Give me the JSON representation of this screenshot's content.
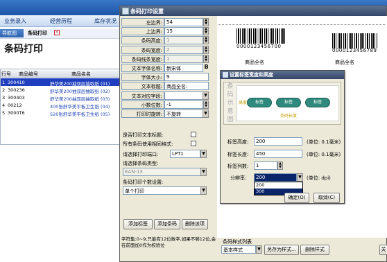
{
  "app": {
    "menu": [
      "业务录入",
      "经营历程",
      "库存状况"
    ],
    "breadcrumb_home": "导航图",
    "breadcrumb_current": "条码打印",
    "page_title": "条码打印",
    "table_headers": [
      "行号",
      "商品编号",
      "商品名名"
    ],
    "rows": [
      {
        "num": "1",
        "code": "300410",
        "name": "舒华美200抽双层抽取纸 (01)",
        "selected": true
      },
      {
        "num": "2",
        "code": "300236",
        "name": "舒华美200抽双层抽取纸 (02)"
      },
      {
        "num": "3",
        "code": "300403",
        "name": "舒华美200抽双层抽取纸 (03)"
      },
      {
        "num": "4",
        "code": "00212",
        "name": "400张舒华美平板卫生纸 (04)"
      },
      {
        "num": "5",
        "code": "3000T6",
        "name": "520张舒华美平板卫生纸 (05)"
      }
    ]
  },
  "dialog": {
    "title": "条码打印设置",
    "fields": [
      {
        "label": "左边界:",
        "value": "54",
        "type": "spin"
      },
      {
        "label": "上边界:",
        "value": "15",
        "type": "spin"
      },
      {
        "label": "条码高度:",
        "value": "1",
        "type": "spin",
        "disabled": true
      },
      {
        "label": "条码宽度:",
        "value": "2",
        "type": "spin",
        "disabled": true
      },
      {
        "label": "条码线条宽度:",
        "value": "1",
        "type": "spin",
        "disabled": true
      },
      {
        "label": "文本字体名称:",
        "value": "新宋体",
        "type": "font"
      },
      {
        "label": "字体大小:",
        "value": "9",
        "type": "plain"
      },
      {
        "label": "文本标题:",
        "value": "商品全名:",
        "type": "plain"
      },
      {
        "label": "文本对应字段:",
        "value": "",
        "type": "dropdown"
      },
      {
        "label": "小数位数:",
        "value": "-1",
        "type": "spin"
      },
      {
        "label": "打印时旋转:",
        "value": "不旋转",
        "type": "dropdown"
      }
    ],
    "font_btn": "B",
    "check_print_title": "是否打印文本标题:",
    "check_same_format": "所有条码使用相同格式:",
    "port_label": "请选择打印端口:",
    "port_value": "LPT1",
    "type_label": "请选择条码类型:",
    "type_value": "EAN-13",
    "count_label": "条码打印个数设置:",
    "count_value": "单个打印",
    "btn_add_label": "添加标签",
    "btn_add_barcode": "添加条码",
    "btn_delete": "删除该项",
    "hint": "字符集:0~9,只能有12位数字,如果不够12位,会在前面加0作为校验位",
    "barcode_left_text": "0000123456700",
    "barcode_right_text": "0000123456789",
    "product_left": "商品全名",
    "product_right": "商品全名",
    "style_list_label": "条码样式列表",
    "style_value": "基本样式",
    "btn_save_as": "另存为样式...",
    "btn_delete_style": "删除样式"
  },
  "subdialog": {
    "title": "设置标签宽度和高度",
    "schematic_side": "条码示意图",
    "pill_left": "标签",
    "pill_mid": "标签",
    "pill_right": "标签",
    "height_side": "高度",
    "length_caption": "条码长度",
    "label_height": "标签高度:",
    "label_height_value": "200",
    "label_height_unit": "(单位: 0.1毫米)",
    "label_length": "标签长度:",
    "label_length_value": "450",
    "label_length_unit": "(单位: 0.1毫米)",
    "label_columns": "标签列数:",
    "label_columns_value": "1",
    "resolution": "分辨率:",
    "resolution_value": "200",
    "resolution_unit": "(单位: dpi)",
    "resolution_options": [
      "200",
      "300"
    ],
    "ok": "确定(O)",
    "cancel": "取消(C)"
  }
}
